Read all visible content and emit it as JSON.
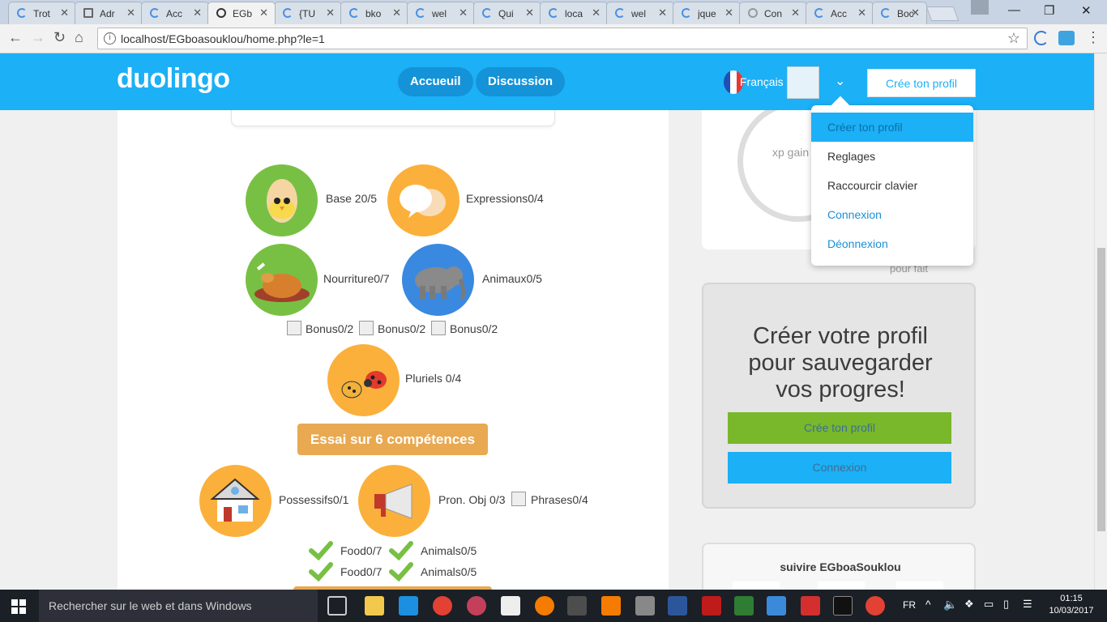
{
  "browser": {
    "tabs": [
      {
        "title": "Trot"
      },
      {
        "title": "Adr"
      },
      {
        "title": "Acc"
      },
      {
        "title": "EGb"
      },
      {
        "title": "{TU"
      },
      {
        "title": "bko"
      },
      {
        "title": "wel"
      },
      {
        "title": "Qui"
      },
      {
        "title": "loca"
      },
      {
        "title": "wel"
      },
      {
        "title": "jque"
      },
      {
        "title": "Con"
      },
      {
        "title": "Acc"
      },
      {
        "title": "Boc"
      }
    ],
    "url": "localhost/EGboasouklou/home.php?le=1"
  },
  "header": {
    "logo": "duolingo",
    "nav_accueil": "Accueuil",
    "nav_discussion": "Discussion",
    "language": "Français",
    "create_profile": "Crée ton profil",
    "flag_colors": [
      "#1f4fb4",
      "#ffffff",
      "#e53935"
    ]
  },
  "dropdown": {
    "items": [
      "Créer ton profil",
      "Reglages",
      "Raccourcir clavier",
      "Connexion",
      "Déonnexion"
    ]
  },
  "skills": {
    "base": "Base 20/5",
    "expressions": "Expressions0/4",
    "nourriture": "Nourriture0/7",
    "animaux": "Animaux0/5",
    "bonus1": "Bonus0/2",
    "bonus2": "Bonus0/2",
    "bonus3": "Bonus0/2",
    "pluriels": "Pluriels 0/4",
    "essai": "Essai sur 6 compétences",
    "possessifs": "Possessifs0/1",
    "pronobj": "Pron. Obj 0/3",
    "phrases": "Phrases0/4",
    "food1": "Food0/7",
    "animals1": "Animals0/5",
    "food2": "Food0/7",
    "animals2": "Animals0/5"
  },
  "sidebar": {
    "xp_label": "xp gain",
    "pour_fait": "pour fait",
    "profile_title_1": "Créer votre profil",
    "profile_title_2": "pour sauvegarder",
    "profile_title_3": "vos progres!",
    "profile_create": "Crée ton profil",
    "profile_login": "Connexion",
    "follow_title": "suivire EGboaSouklou"
  },
  "taskbar": {
    "search_placeholder": "Rechercher sur le web et dans Windows",
    "lang": "FR",
    "time": "01:15",
    "date": "10/03/2017"
  }
}
